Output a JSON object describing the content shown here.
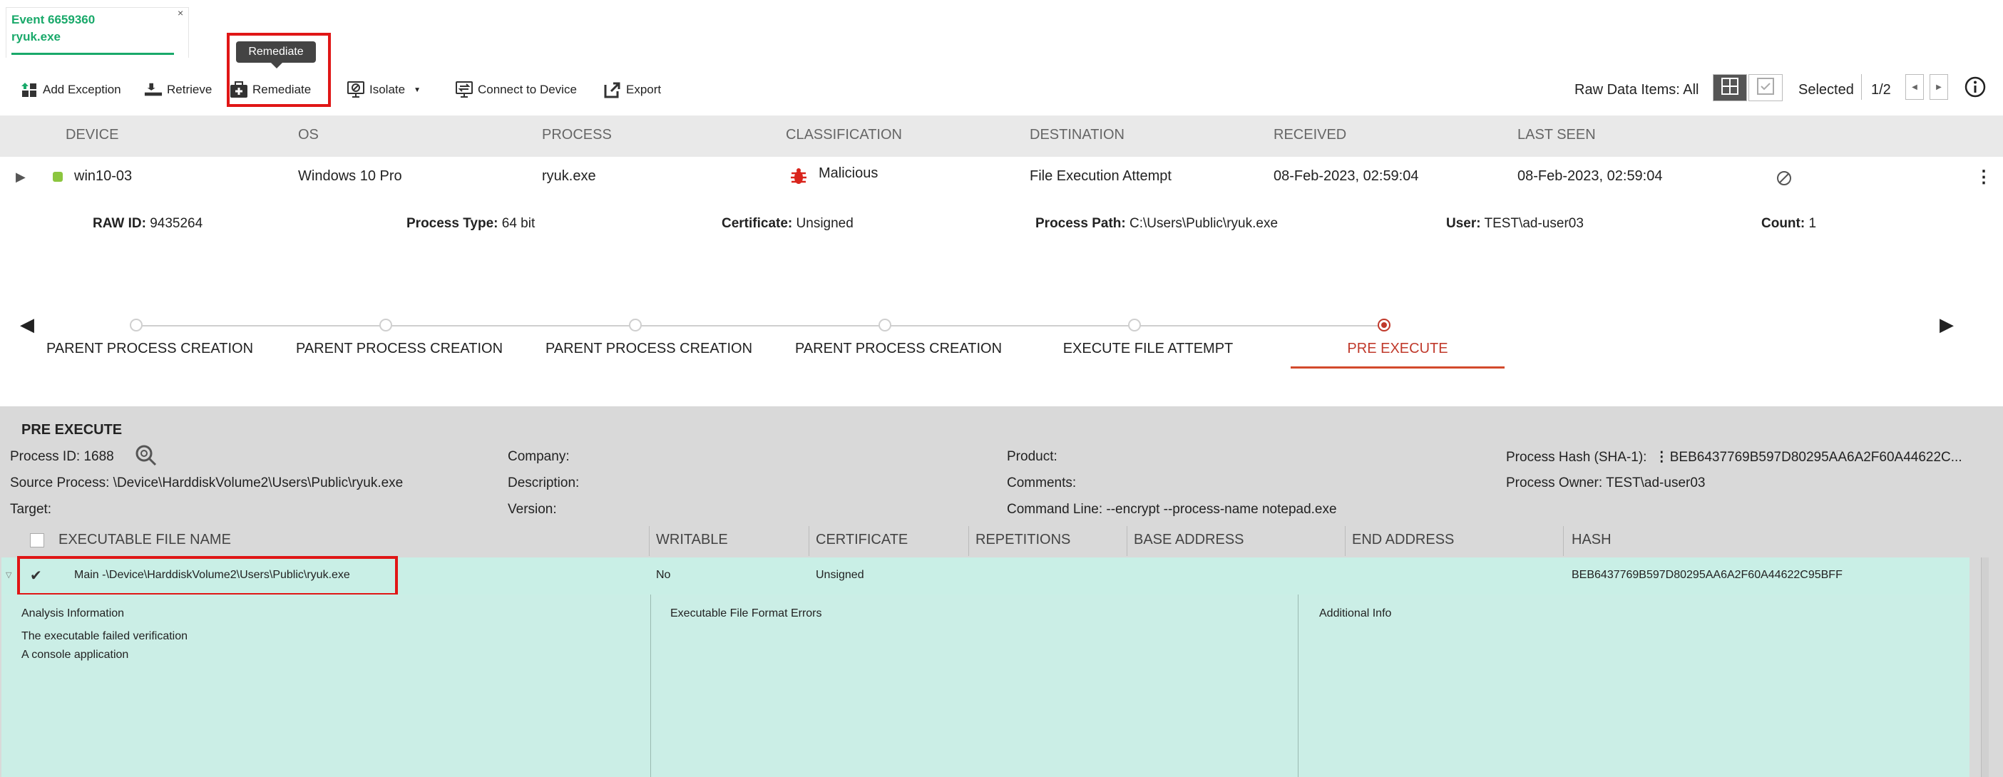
{
  "tab": {
    "line1": "Event 6659360",
    "line2": "ryuk.exe",
    "close": "×"
  },
  "tooltip": {
    "text": "Remediate"
  },
  "toolbar": {
    "add_exception": "Add Exception",
    "retrieve": "Retrieve",
    "remediate": "Remediate",
    "isolate": "Isolate",
    "connect": "Connect to Device",
    "export": "Export"
  },
  "toolbar_right": {
    "raw_data": "Raw Data Items: All",
    "selected": "Selected",
    "pager": "1/2"
  },
  "columns": {
    "device": "DEVICE",
    "os": "OS",
    "process": "PROCESS",
    "classification": "CLASSIFICATION",
    "destination": "DESTINATION",
    "received": "RECEIVED",
    "last_seen": "LAST SEEN"
  },
  "event_row": {
    "device": "win10-03",
    "os": "Windows 10 Pro",
    "process": "ryuk.exe",
    "classification": "Malicious",
    "destination": "File Execution Attempt",
    "received": "08-Feb-2023, 02:59:04",
    "last_seen": "08-Feb-2023, 02:59:04",
    "status_color": "#8cc63f",
    "malicious_color": "#d9241c"
  },
  "details": {
    "raw_id_label": "RAW ID:",
    "raw_id": " 9435264",
    "ptype_label": "Process Type:",
    "ptype": " 64 bit",
    "cert_label": "Certificate:",
    "cert": " Unsigned",
    "path_label": "Process Path:",
    "path": " C:\\Users\\Public\\ryuk.exe",
    "user_label": "User:",
    "user": " TEST\\ad-user03",
    "count_label": "Count:",
    "count": " 1"
  },
  "timeline": {
    "steps": [
      "PARENT PROCESS CREATION",
      "PARENT PROCESS CREATION",
      "PARENT PROCESS CREATION",
      "PARENT PROCESS CREATION",
      "EXECUTE FILE ATTEMPT",
      "PRE EXECUTE"
    ],
    "active_color": "#c0392b"
  },
  "pre_execute": {
    "title": "PRE EXECUTE",
    "pid_label": "Process ID:",
    "pid": " 1688",
    "source_label": "Source Process:",
    "source": " \\Device\\HarddiskVolume2\\Users\\Public\\ryuk.exe",
    "target_label": "Target:",
    "company_label": "Company:",
    "description_label": "Description:",
    "version_label": "Version:",
    "product_label": "Product:",
    "comments_label": "Comments:",
    "cmd_label": "Command Line:",
    "cmd": " --encrypt --process-name notepad.exe",
    "hash_label": "Process Hash (SHA-1):",
    "hash": "BEB6437769B597D80295AA6A2F60A44622C...",
    "owner_label": "Process Owner:",
    "owner": " TEST\\ad-user03"
  },
  "file_table": {
    "headers": [
      "EXECUTABLE FILE NAME",
      "WRITABLE",
      "CERTIFICATE",
      "REPETITIONS",
      "BASE ADDRESS",
      "END ADDRESS",
      "HASH"
    ],
    "row": {
      "name": "Main -\\Device\\HarddiskVolume2\\Users\\Public\\ryuk.exe",
      "writable": "No",
      "certificate": "Unsigned",
      "hash": "BEB6437769B597D80295AA6A2F60A44622C95BFF"
    }
  },
  "analysis": {
    "title": "Analysis Information",
    "line1": "The executable failed verification",
    "line2": "A console application",
    "format_errors": "Executable File Format Errors",
    "additional": "Additional Info"
  }
}
